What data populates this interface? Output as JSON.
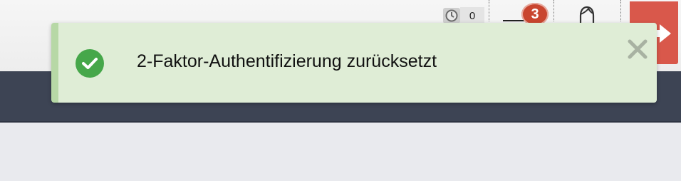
{
  "header": {
    "timer": {
      "icon": "clock-icon",
      "count": "0"
    },
    "notifications": {
      "icon": "inbox-icon",
      "badge": "3",
      "badge_color": "#c9452f"
    },
    "user": {
      "icon": "user-icon"
    },
    "logout": {
      "icon": "logout-icon",
      "color": "#d9584b"
    }
  },
  "toast": {
    "status_icon": "check-circle-icon",
    "message": "2-Faktor-Authentifizierung zurücksetzt",
    "close_icon": "close-icon",
    "background": "#dfedd6",
    "accent": "#46a74a"
  },
  "theme": {
    "navbar": "#3d4454",
    "page_background": "#e9eaee"
  }
}
